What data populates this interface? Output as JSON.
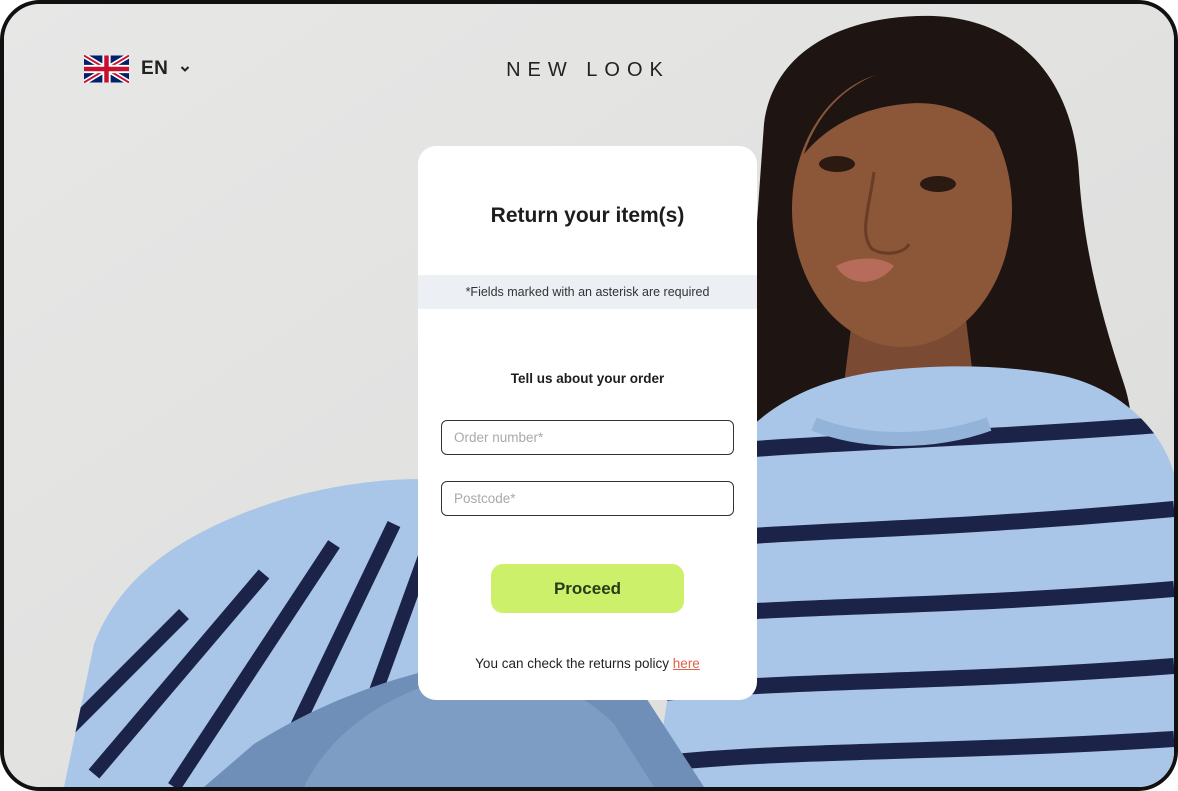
{
  "header": {
    "language": {
      "code": "EN",
      "flag_icon": "uk-flag-icon",
      "dropdown_icon": "chevron-down-icon"
    },
    "brand": "NEW LOOK"
  },
  "form": {
    "title": "Return your item(s)",
    "required_notice": "*Fields marked with an asterisk are required",
    "section_title": "Tell us about your order",
    "order_number": {
      "value": "",
      "placeholder": "Order number*"
    },
    "postcode": {
      "value": "",
      "placeholder": "Postcode*"
    },
    "proceed_label": "Proceed",
    "policy_text": "You can check the returns policy ",
    "policy_link": "here"
  },
  "colors": {
    "accent_button": "#ccf069",
    "link": "#e0604a",
    "sweater_blue": "#a9c6e8",
    "stripe_navy": "#1b2448",
    "denim": "#6f8fb8"
  }
}
